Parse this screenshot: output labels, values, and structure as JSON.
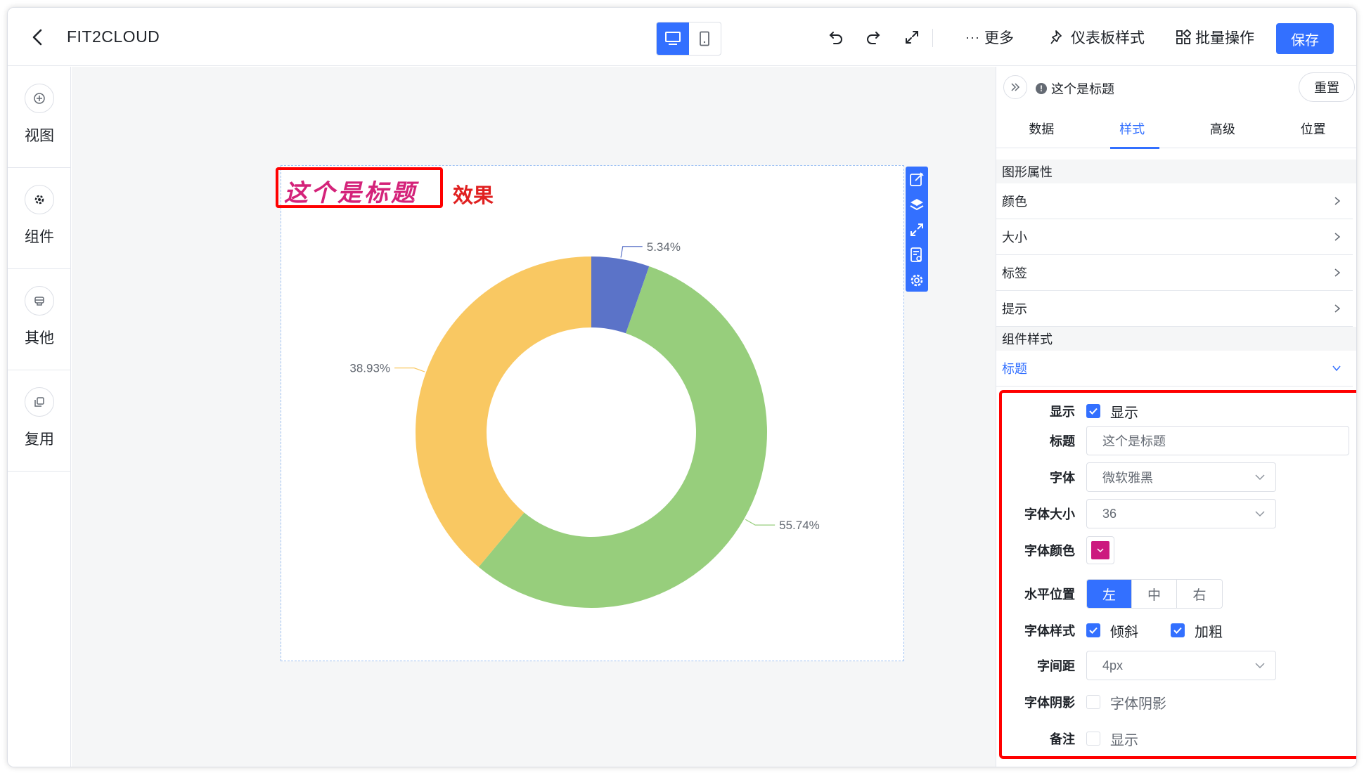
{
  "header": {
    "title": "FIT2CLOUD",
    "more_label": "更多",
    "dashboard_style_label": "仪表板样式",
    "batch_label": "批量操作",
    "save_label": "保存"
  },
  "sidebar": {
    "items": [
      {
        "label": "视图",
        "icon": "plus-circle-icon"
      },
      {
        "label": "组件",
        "icon": "gear-icon"
      },
      {
        "label": "其他",
        "icon": "stamp-icon"
      },
      {
        "label": "复用",
        "icon": "copy-icon"
      }
    ]
  },
  "canvas": {
    "widget_title": "这个是标题",
    "effect_label": "效果"
  },
  "chart_data": {
    "type": "pie",
    "donut": true,
    "labels": [
      "5.34%",
      "55.74%",
      "38.93%"
    ],
    "values": [
      5.34,
      55.74,
      38.93
    ],
    "colors": [
      "#5b73c8",
      "#97ce7c",
      "#f9c862"
    ]
  },
  "panel": {
    "component_name": "这个是标题",
    "reset_label": "重置",
    "tabs": [
      {
        "label": "数据"
      },
      {
        "label": "样式",
        "active": true
      },
      {
        "label": "高级"
      },
      {
        "label": "位置"
      }
    ],
    "section_graphic": "图形属性",
    "graphic_rows": [
      "颜色",
      "大小",
      "标签",
      "提示"
    ],
    "section_component": "组件样式",
    "open_row": "标题",
    "form": {
      "show_label": "显示",
      "show_checkbox_text": "显示",
      "title_label": "标题",
      "title_value": "这个是标题",
      "font_label": "字体",
      "font_value": "微软雅黑",
      "size_label": "字体大小",
      "size_value": "36",
      "color_label": "字体颜色",
      "color_value": "#cc1a7f",
      "halign_label": "水平位置",
      "halign_options": [
        "左",
        "中",
        "右"
      ],
      "halign_selected": "左",
      "fontstyle_label": "字体样式",
      "italic_text": "倾斜",
      "bold_text": "加粗",
      "spacing_label": "字间距",
      "spacing_value": "4px",
      "shadow_label": "字体阴影",
      "shadow_text": "字体阴影",
      "remark_label": "备注",
      "remark_text": "显示"
    }
  }
}
